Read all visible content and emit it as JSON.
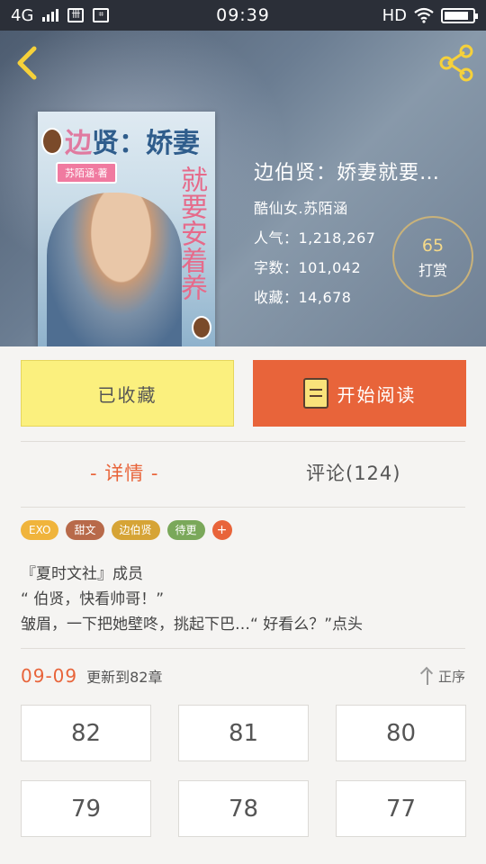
{
  "statusbar": {
    "network": "4G",
    "time": "09:39",
    "hd": "HD"
  },
  "book": {
    "title": "边伯贤：娇妻就要…",
    "author": "酷仙女.苏陌涵",
    "popularity": "人气：1,218,267",
    "word_count": "字数：101,042",
    "favorites": "收藏：14,678",
    "tip_count": "65",
    "tip_label": "打赏",
    "cover": {
      "title_main": "贤：娇妻",
      "title_prefix": "边",
      "author_badge": "苏陌涵·著",
      "side_text": "就要安着养"
    }
  },
  "actions": {
    "collected_label": "已收藏",
    "read_label": "开始阅读"
  },
  "tabs": {
    "detail": "- 详情 -",
    "comments": "评论(124)"
  },
  "tags": [
    {
      "label": "EXO",
      "color": "#f0b43c"
    },
    {
      "label": "甜文",
      "color": "#b86a4a"
    },
    {
      "label": "边伯贤",
      "color": "#d6a436"
    },
    {
      "label": "待更",
      "color": "#7aa85a"
    },
    {
      "label": "+",
      "color": "#e8643a"
    }
  ],
  "description": [
    "『夏时文社』成员",
    "“ 伯贤，快看帅哥！”",
    "皱眉，一下把她壁咚，挑起下巴…“ 好看么？”点头"
  ],
  "update": {
    "date": "09-09",
    "text": "更新到82章",
    "sort_label": "正序"
  },
  "chapters": [
    "82",
    "81",
    "80",
    "79",
    "78",
    "77"
  ],
  "colors": {
    "accent": "#e8643a",
    "collected_bg": "#fbf07e"
  }
}
